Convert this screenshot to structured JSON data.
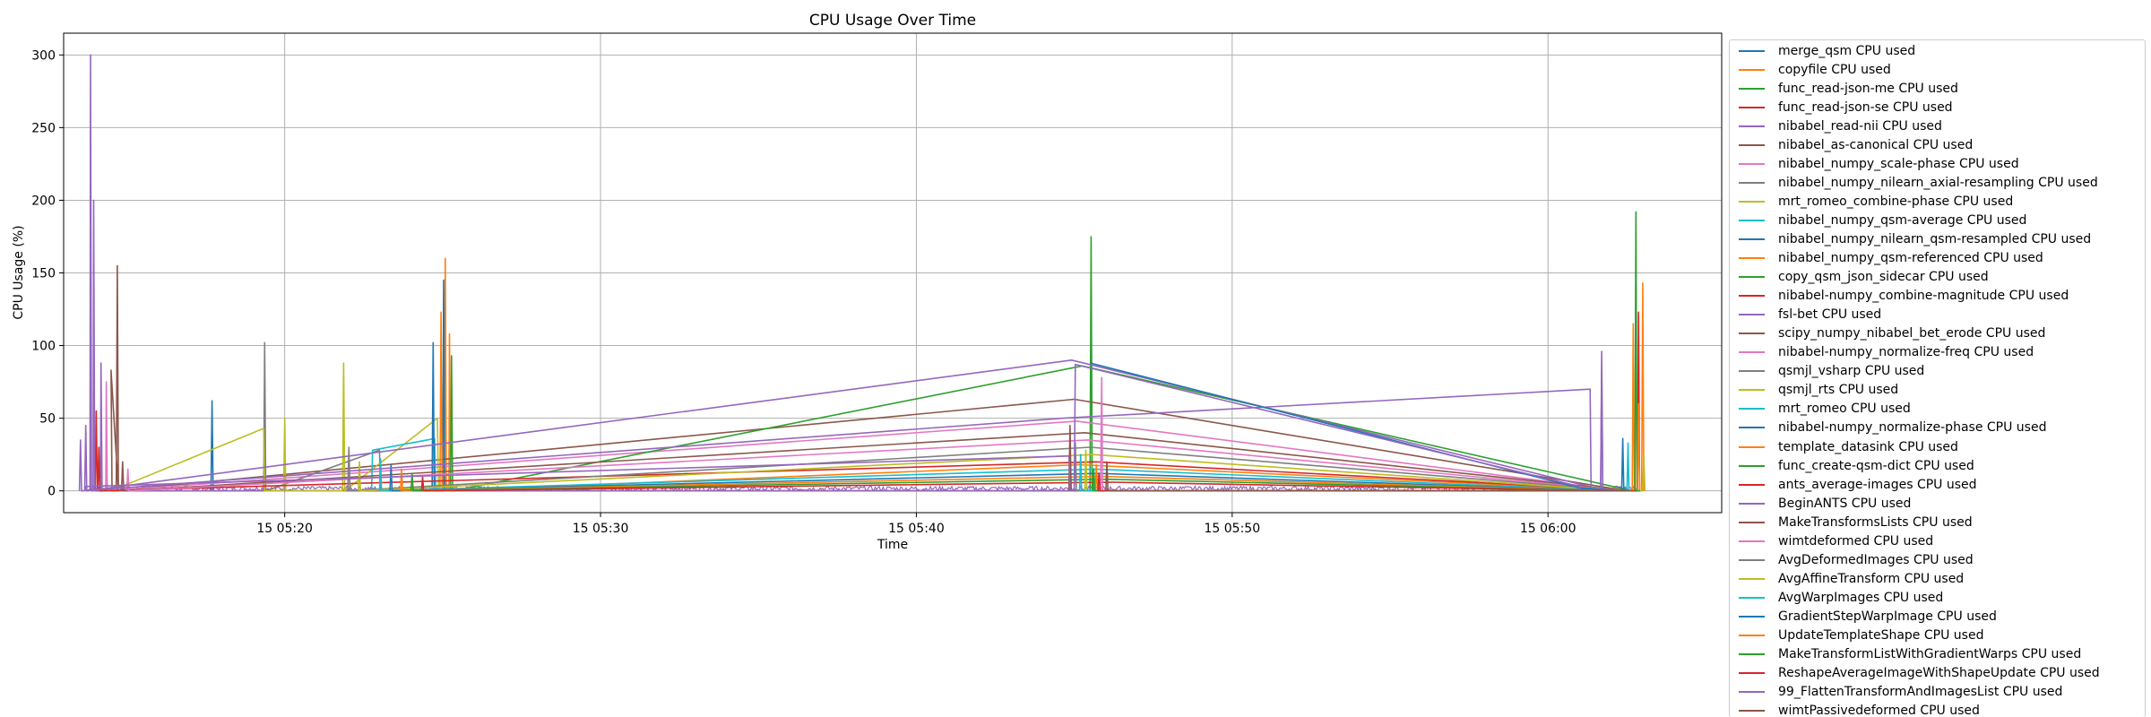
{
  "chart_data": {
    "type": "line",
    "title": "CPU Usage Over Time",
    "xlabel": "Time",
    "ylabel": "CPU Usage (%)",
    "ylim": [
      -15,
      315
    ],
    "xlim": [
      "05:13:00",
      "06:05:30"
    ],
    "grid": true,
    "legend_position": "outside-right",
    "y_ticks": [
      0,
      50,
      100,
      150,
      200,
      250,
      300
    ],
    "x_ticks": [
      {
        "value": "05:20:00",
        "label": "15 05:20"
      },
      {
        "value": "05:30:00",
        "label": "15 05:30"
      },
      {
        "value": "05:40:00",
        "label": "15 05:40"
      },
      {
        "value": "05:50:00",
        "label": "15 05:50"
      },
      {
        "value": "06:00:00",
        "label": "15 06:00"
      }
    ],
    "series": [
      {
        "name": "merge_qsm CPU used",
        "color": "#1f77b4",
        "points": [
          [
            "05:17:40",
            0
          ],
          [
            "05:17:42",
            62
          ],
          [
            "05:17:44",
            0
          ],
          [
            "05:44:50",
            0
          ],
          [
            "05:44:52",
            30
          ],
          [
            "05:44:54",
            0
          ]
        ]
      },
      {
        "name": "copyfile CPU used",
        "color": "#ff7f0e",
        "points": [
          [
            "05:25:03",
            0
          ],
          [
            "05:25:05",
            160
          ],
          [
            "05:25:07",
            0
          ],
          [
            "05:25:12",
            0
          ],
          [
            "05:25:13",
            108
          ],
          [
            "05:25:15",
            0
          ],
          [
            "06:02:40",
            0
          ],
          [
            "06:02:42",
            115
          ],
          [
            "06:02:44",
            0
          ],
          [
            "06:02:58",
            0
          ],
          [
            "06:03:00",
            143
          ],
          [
            "06:03:02",
            0
          ]
        ]
      },
      {
        "name": "func_read-json-me CPU used",
        "color": "#2ca02c",
        "points": [
          [
            "05:45:30",
            0
          ],
          [
            "05:45:32",
            175
          ],
          [
            "05:45:34",
            0
          ],
          [
            "06:02:45",
            0
          ],
          [
            "06:02:47",
            192
          ],
          [
            "06:02:49",
            0
          ]
        ]
      },
      {
        "name": "func_read-json-se CPU used",
        "color": "#d62728",
        "points": [
          [
            "05:14:00",
            0
          ],
          [
            "05:14:02",
            55
          ],
          [
            "05:14:04",
            0
          ],
          [
            "06:02:50",
            0
          ],
          [
            "06:02:52",
            123
          ],
          [
            "06:02:54",
            0
          ]
        ]
      },
      {
        "name": "nibabel_read-nii CPU used",
        "color": "#9467bd",
        "points": [
          [
            "05:13:50",
            0
          ],
          [
            "05:13:51",
            300
          ],
          [
            "05:13:53",
            0
          ],
          [
            "05:13:56",
            0
          ],
          [
            "05:13:57",
            200
          ],
          [
            "05:13:59",
            0
          ],
          [
            "05:14:10",
            0
          ],
          [
            "05:14:11",
            88
          ],
          [
            "05:14:13",
            0
          ],
          [
            "06:01:40",
            0
          ],
          [
            "06:01:42",
            96
          ],
          [
            "06:01:44",
            0
          ]
        ]
      },
      {
        "name": "nibabel_as-canonical CPU used",
        "color": "#8c564b",
        "points": [
          [
            "05:14:40",
            0
          ],
          [
            "05:14:42",
            155
          ],
          [
            "05:14:44",
            0
          ],
          [
            "05:14:30",
            83
          ],
          [
            "05:14:32",
            0
          ],
          [
            "05:45:00",
            63
          ],
          [
            "06:02:30",
            0
          ]
        ]
      },
      {
        "name": "nibabel_numpy_scale-phase CPU used",
        "color": "#e377c2",
        "points": [
          [
            "05:14:20",
            0
          ],
          [
            "05:14:21",
            75
          ],
          [
            "05:14:23",
            0
          ],
          [
            "05:45:05",
            48
          ],
          [
            "06:02:20",
            0
          ]
        ]
      },
      {
        "name": "nibabel_numpy_nilearn_axial-resampling CPU used",
        "color": "#7f7f7f",
        "points": [
          [
            "05:19:20",
            0
          ],
          [
            "05:19:22",
            102
          ],
          [
            "05:19:24",
            0
          ],
          [
            "05:23:00",
            28
          ],
          [
            "05:23:02",
            0
          ]
        ]
      },
      {
        "name": "mrt_romeo_combine-phase CPU used",
        "color": "#bcbd22",
        "points": [
          [
            "05:14:30",
            0
          ],
          [
            "05:19:20",
            43
          ],
          [
            "05:19:22",
            0
          ],
          [
            "05:19:58",
            0
          ],
          [
            "05:20:00",
            50
          ],
          [
            "05:20:02",
            0
          ],
          [
            "05:21:50",
            0
          ],
          [
            "05:21:52",
            88
          ],
          [
            "05:21:54",
            0
          ],
          [
            "05:24:50",
            50
          ],
          [
            "05:24:52",
            0
          ]
        ]
      },
      {
        "name": "nibabel_numpy_qsm-average CPU used",
        "color": "#17becf",
        "points": [
          [
            "05:22:45",
            0
          ],
          [
            "05:22:47",
            28
          ],
          [
            "05:24:45",
            36
          ],
          [
            "05:24:47",
            0
          ]
        ]
      },
      {
        "name": "nibabel_numpy_nilearn_qsm-resampled CPU used",
        "color": "#1f77b4",
        "points": [
          [
            "05:24:40",
            0
          ],
          [
            "05:24:42",
            102
          ],
          [
            "05:24:44",
            0
          ],
          [
            "05:25:00",
            0
          ],
          [
            "05:25:02",
            145
          ],
          [
            "05:25:04",
            0
          ]
        ]
      },
      {
        "name": "nibabel_numpy_qsm-referenced CPU used",
        "color": "#ff7f0e",
        "points": [
          [
            "05:24:55",
            0
          ],
          [
            "05:24:57",
            123
          ],
          [
            "05:24:59",
            0
          ],
          [
            "05:45:10",
            18
          ],
          [
            "06:02:35",
            0
          ]
        ]
      },
      {
        "name": "copy_qsm_json_sidecar CPU used",
        "color": "#2ca02c",
        "points": [
          [
            "05:25:15",
            0
          ],
          [
            "05:25:17",
            93
          ],
          [
            "05:25:19",
            0
          ],
          [
            "05:45:15",
            86
          ],
          [
            "06:02:40",
            0
          ]
        ]
      },
      {
        "name": "nibabel-numpy_combine-magnitude CPU used",
        "color": "#d62728",
        "points": [
          [
            "05:14:05",
            0
          ],
          [
            "05:14:07",
            30
          ],
          [
            "05:14:09",
            0
          ],
          [
            "05:45:40",
            20
          ],
          [
            "06:02:40",
            0
          ]
        ]
      },
      {
        "name": "fsl-bet CPU used",
        "color": "#9467bd",
        "points": [
          [
            "05:13:40",
            0
          ],
          [
            "05:13:42",
            45
          ],
          [
            "05:13:44",
            0
          ],
          [
            "05:44:55",
            90
          ],
          [
            "06:01:30",
            2
          ],
          [
            "06:01:32",
            0
          ]
        ]
      },
      {
        "name": "scipy_numpy_nibabel_bet_erode CPU used",
        "color": "#8c564b",
        "points": [
          [
            "05:14:50",
            0
          ],
          [
            "05:14:52",
            20
          ],
          [
            "05:14:54",
            0
          ],
          [
            "05:45:20",
            40
          ],
          [
            "06:02:30",
            0
          ]
        ]
      },
      {
        "name": "nibabel-numpy_normalize-freq CPU used",
        "color": "#e377c2",
        "points": [
          [
            "05:15:00",
            0
          ],
          [
            "05:15:02",
            15
          ],
          [
            "05:15:04",
            0
          ],
          [
            "05:45:25",
            35
          ],
          [
            "06:02:25",
            0
          ]
        ]
      },
      {
        "name": "qsmjl_vsharp CPU used",
        "color": "#7f7f7f",
        "points": [
          [
            "05:22:00",
            0
          ],
          [
            "05:22:02",
            30
          ],
          [
            "05:22:04",
            0
          ],
          [
            "05:45:30",
            30
          ],
          [
            "06:02:20",
            0
          ]
        ]
      },
      {
        "name": "qsmjl_rts CPU used",
        "color": "#bcbd22",
        "points": [
          [
            "05:22:20",
            0
          ],
          [
            "05:22:22",
            20
          ],
          [
            "05:22:24",
            0
          ],
          [
            "05:45:35",
            25
          ],
          [
            "06:02:15",
            0
          ]
        ]
      },
      {
        "name": "mrt_romeo CPU used",
        "color": "#17becf",
        "points": [
          [
            "05:23:00",
            0
          ],
          [
            "05:23:02",
            22
          ],
          [
            "05:23:04",
            0
          ],
          [
            "05:45:40",
            15
          ],
          [
            "06:02:10",
            0
          ]
        ]
      },
      {
        "name": "nibabel-numpy_normalize-phase CPU used",
        "color": "#1f77b4",
        "points": [
          [
            "05:23:20",
            0
          ],
          [
            "05:23:22",
            18
          ],
          [
            "05:23:24",
            0
          ],
          [
            "05:45:45",
            12
          ],
          [
            "06:02:05",
            0
          ]
        ]
      },
      {
        "name": "template_datasink CPU used",
        "color": "#ff7f0e",
        "points": [
          [
            "05:23:40",
            0
          ],
          [
            "05:23:42",
            15
          ],
          [
            "05:23:44",
            0
          ],
          [
            "05:45:50",
            10
          ],
          [
            "06:02:00",
            0
          ]
        ]
      },
      {
        "name": "func_create-qsm-dict CPU used",
        "color": "#2ca02c",
        "points": [
          [
            "05:24:00",
            0
          ],
          [
            "05:24:02",
            12
          ],
          [
            "05:24:04",
            0
          ],
          [
            "05:46:00",
            8
          ],
          [
            "06:01:55",
            0
          ]
        ]
      },
      {
        "name": "ants_average-images CPU used",
        "color": "#d62728",
        "points": [
          [
            "05:24:20",
            0
          ],
          [
            "05:24:22",
            10
          ],
          [
            "05:24:24",
            0
          ],
          [
            "05:46:10",
            6
          ],
          [
            "06:01:50",
            0
          ]
        ]
      },
      {
        "name": "BeginANTS CPU used",
        "color": "#9467bd",
        "points": [
          [
            "05:13:30",
            0
          ],
          [
            "05:13:32",
            35
          ],
          [
            "05:13:34",
            0
          ],
          [
            "05:44:40",
            50
          ],
          [
            "06:01:20",
            70
          ],
          [
            "06:01:22",
            0
          ],
          [
            "06:01:40",
            0
          ],
          [
            "06:01:42",
            83
          ],
          [
            "06:01:44",
            0
          ]
        ]
      },
      {
        "name": "MakeTransformsLists CPU used",
        "color": "#8c564b",
        "points": [
          [
            "05:44:50",
            0
          ],
          [
            "05:44:52",
            45
          ],
          [
            "05:44:54",
            0
          ],
          [
            "06:02:50",
            0
          ]
        ]
      },
      {
        "name": "wimtdeformed CPU used",
        "color": "#e377c2",
        "points": [
          [
            "05:45:50",
            0
          ],
          [
            "05:45:52",
            78
          ],
          [
            "05:45:54",
            0
          ],
          [
            "06:02:00",
            0
          ]
        ]
      },
      {
        "name": "AvgDeformedImages CPU used",
        "color": "#7f7f7f",
        "points": [
          [
            "05:45:00",
            0
          ],
          [
            "05:45:02",
            33
          ],
          [
            "05:45:04",
            0
          ],
          [
            "06:02:00",
            0
          ]
        ]
      },
      {
        "name": "AvgAffineTransform CPU used",
        "color": "#bcbd22",
        "points": [
          [
            "05:45:20",
            0
          ],
          [
            "05:45:22",
            28
          ],
          [
            "05:45:24",
            0
          ],
          [
            "06:03:00",
            0
          ],
          [
            "06:03:02",
            25
          ],
          [
            "06:03:04",
            0
          ]
        ]
      },
      {
        "name": "AvgWarpImages CPU used",
        "color": "#17becf",
        "points": [
          [
            "05:45:10",
            0
          ],
          [
            "05:45:12",
            25
          ],
          [
            "05:45:14",
            0
          ],
          [
            "06:02:30",
            0
          ],
          [
            "06:02:32",
            33
          ],
          [
            "06:02:34",
            0
          ]
        ]
      },
      {
        "name": "GradientStepWarpImage CPU used",
        "color": "#1f77b4",
        "points": [
          [
            "05:45:30",
            88
          ],
          [
            "06:01:00",
            2
          ],
          [
            "06:02:20",
            0
          ],
          [
            "06:02:22",
            36
          ],
          [
            "06:02:24",
            0
          ]
        ]
      },
      {
        "name": "UpdateTemplateShape CPU used",
        "color": "#ff7f0e",
        "points": [
          [
            "05:45:40",
            0
          ],
          [
            "05:45:42",
            18
          ],
          [
            "05:45:44",
            0
          ],
          [
            "06:02:50",
            0
          ],
          [
            "06:02:52",
            60
          ],
          [
            "06:02:54",
            0
          ]
        ]
      },
      {
        "name": "MakeTransformListWithGradientWarps CPU used",
        "color": "#2ca02c",
        "points": [
          [
            "05:45:35",
            0
          ],
          [
            "05:45:37",
            15
          ],
          [
            "05:45:39",
            0
          ],
          [
            "06:02:55",
            0
          ]
        ]
      },
      {
        "name": "ReshapeAverageImageWithShapeUpdate CPU used",
        "color": "#d62728",
        "points": [
          [
            "05:45:45",
            0
          ],
          [
            "05:45:47",
            12
          ],
          [
            "05:45:49",
            0
          ],
          [
            "06:02:45",
            0
          ]
        ]
      },
      {
        "name": "99_FlattenTransformAndImagesList CPU used",
        "color": "#9467bd",
        "points": [
          [
            "05:13:40",
            0
          ],
          [
            "05:13:42",
            3
          ],
          [
            "05:44:50",
            24
          ],
          [
            "05:44:52",
            0
          ],
          [
            "05:45:00",
            0
          ],
          [
            "05:45:02",
            87
          ],
          [
            "06:01:00",
            3
          ],
          [
            "06:01:02",
            0
          ]
        ]
      },
      {
        "name": "wimtPassivedeformed CPU used",
        "color": "#8c564b",
        "points": [
          [
            "05:46:00",
            0
          ],
          [
            "05:46:02",
            20
          ],
          [
            "05:46:04",
            0
          ],
          [
            "06:02:40",
            0
          ]
        ]
      }
    ]
  }
}
